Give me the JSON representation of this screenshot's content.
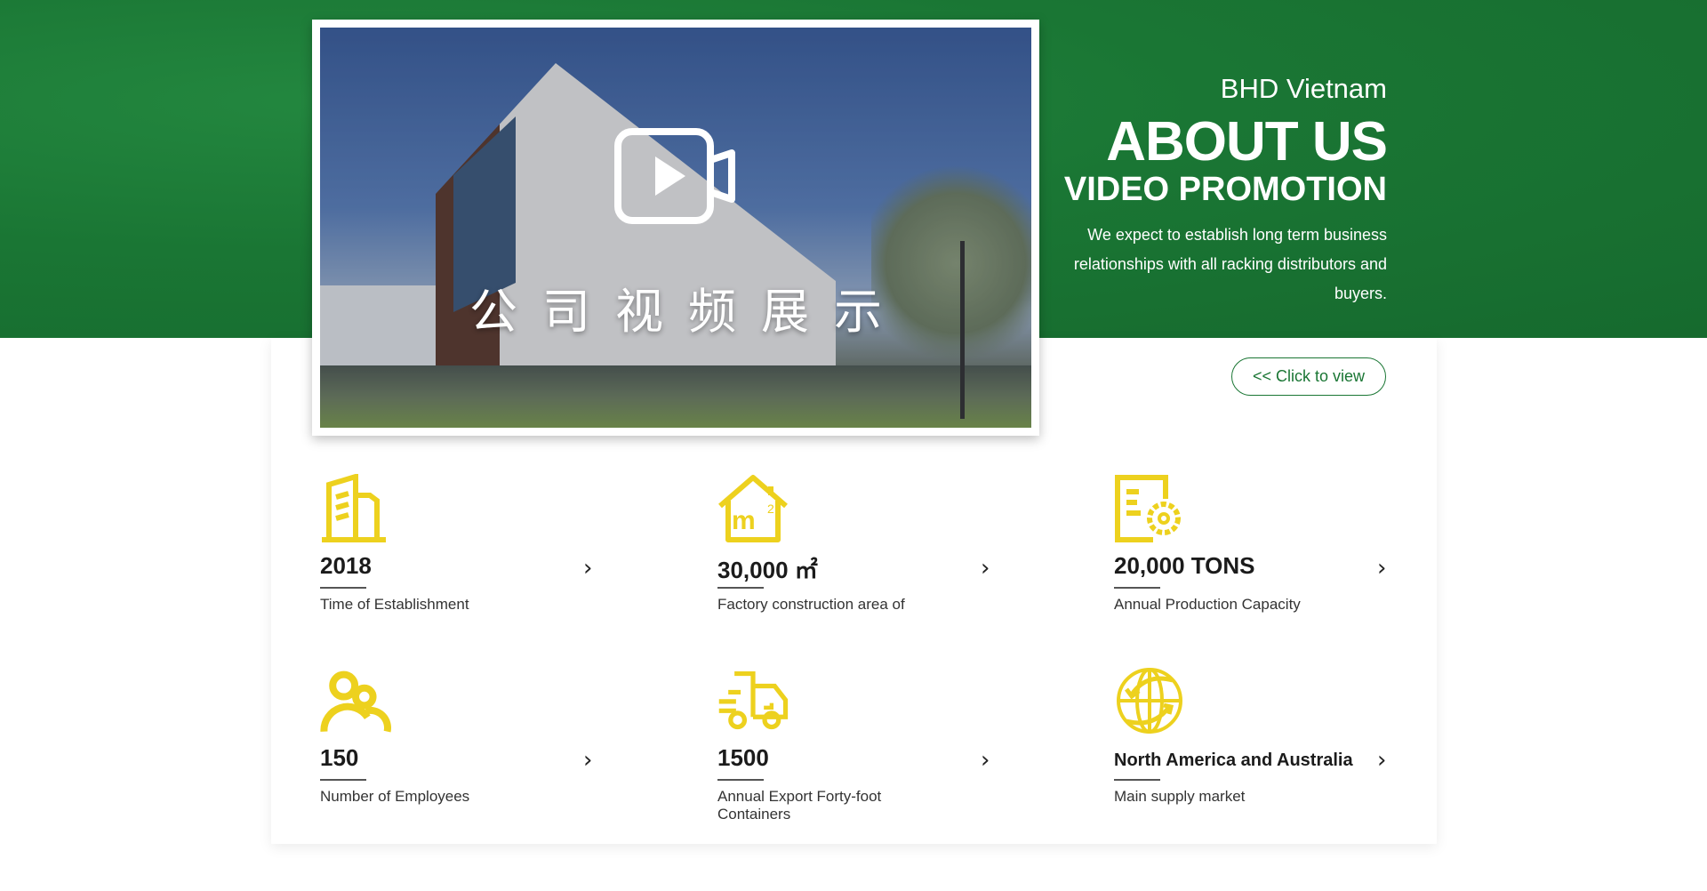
{
  "header": {
    "subtitle": "BHD Vietnam",
    "title": "ABOUT US",
    "title2": "VIDEO PROMOTION",
    "description": "We expect to establish long term business relationships with all racking distributors and buyers.",
    "cta": "<< Click to view"
  },
  "video": {
    "caption": "公司视频展示",
    "icon": "video-play-icon"
  },
  "colors": {
    "green": "#1a7634",
    "icon_yellow": "#EDD11E"
  },
  "stats": [
    {
      "value": "2018",
      "label": "Time of Establishment",
      "icon": "building-icon"
    },
    {
      "value": "30,000 ㎡",
      "label": "Factory construction area of",
      "icon": "house-area-icon"
    },
    {
      "value": "20,000 TONS",
      "label": "Annual Production Capacity",
      "icon": "document-gear-icon"
    },
    {
      "value": "150",
      "label": "Number of Employees",
      "icon": "people-icon"
    },
    {
      "value": "1500",
      "label": "Annual Export Forty-foot Containers",
      "icon": "truck-icon"
    },
    {
      "value": "North America and Australia",
      "label": "Main supply market",
      "icon": "globe-icon"
    }
  ]
}
